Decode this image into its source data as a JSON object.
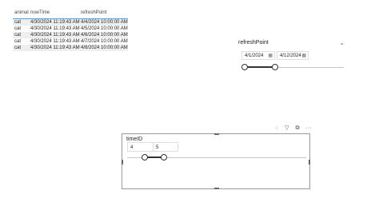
{
  "table": {
    "headers": [
      "animal",
      "nowTime",
      "refreshPoint"
    ],
    "rows": [
      [
        "cat",
        "4/30/2024 11:19:43 AM",
        "4/4/2024 10:00:00 AM"
      ],
      [
        "cat",
        "4/30/2024 11:19:43 AM",
        "4/5/2024 10:00:00 AM"
      ],
      [
        "cat",
        "4/30/2024 11:19:43 AM",
        "4/6/2024 10:00:00 AM"
      ],
      [
        "cat",
        "4/30/2024 11:19:43 AM",
        "4/7/2024 10:00:00 AM"
      ],
      [
        "cat",
        "4/30/2024 11:19:43 AM",
        "4/8/2024 10:00:00 AM"
      ]
    ]
  },
  "slicer_refresh": {
    "title": "refreshPoint",
    "start": "4/1/2024",
    "end": "4/12/2024",
    "chevron_icon": "chevron-down-icon",
    "calendar_icon": "calendar-icon"
  },
  "slicer_time": {
    "title": "timeID",
    "min": "4",
    "max": "5"
  },
  "visual_header": {
    "icons": [
      "pin-icon",
      "filter-icon",
      "focus-mode-icon",
      "more-options-icon"
    ]
  },
  "colors": {
    "table_header_underline": "#4aa3df",
    "track": "#333333",
    "border": "#9a9a9a"
  }
}
